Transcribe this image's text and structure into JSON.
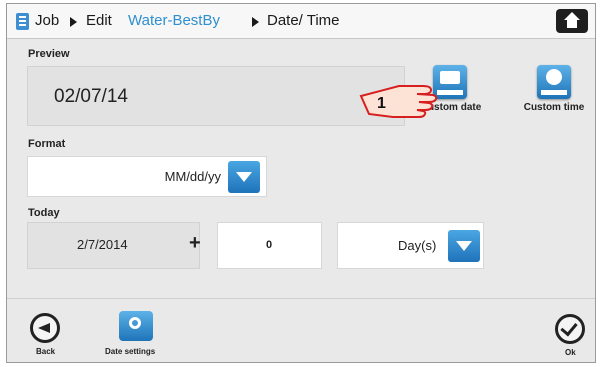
{
  "header": {
    "crumbs": [
      "Job",
      "Edit",
      "Water-BestBy",
      "Date/ Time"
    ]
  },
  "preview": {
    "label": "Preview",
    "value": "02/07/14",
    "custom_date_label": "Custom date",
    "custom_time_label": "Custom time",
    "callout_number": "1"
  },
  "format": {
    "label": "Format",
    "value": "MM/dd/yy"
  },
  "today": {
    "label": "Today",
    "date": "2/7/2014",
    "plus": "+",
    "offset": "0",
    "unit": "Day(s)"
  },
  "footer": {
    "back_label": "Back",
    "date_settings_label": "Date settings",
    "ok_label": "Ok"
  },
  "colors": {
    "accent": "#2f8fcf",
    "button_blue": "#1e74b8",
    "background": "#e9e9e9"
  }
}
